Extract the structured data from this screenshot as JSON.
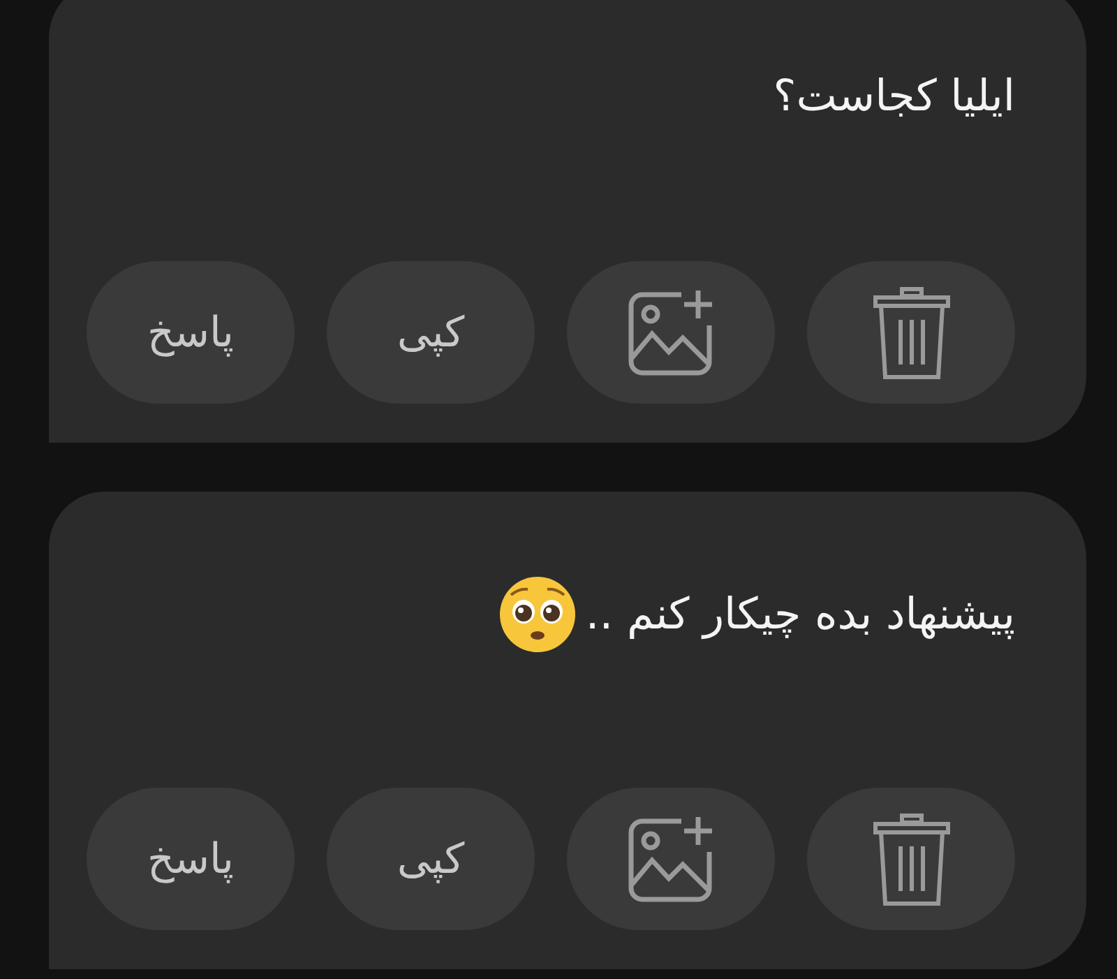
{
  "messages": [
    {
      "text": "ایلیا کجاست؟",
      "emoji": false,
      "actions": [
        {
          "kind": "delete"
        },
        {
          "kind": "image"
        },
        {
          "kind": "text",
          "label": "کپی"
        },
        {
          "kind": "text",
          "label": "پاسخ"
        }
      ]
    },
    {
      "text": "پیشنهاد بده چیکار کنم ..",
      "emoji": true,
      "actions": [
        {
          "kind": "delete"
        },
        {
          "kind": "image"
        },
        {
          "kind": "text",
          "label": "کپی"
        },
        {
          "kind": "text",
          "label": "پاسخ"
        }
      ]
    }
  ]
}
